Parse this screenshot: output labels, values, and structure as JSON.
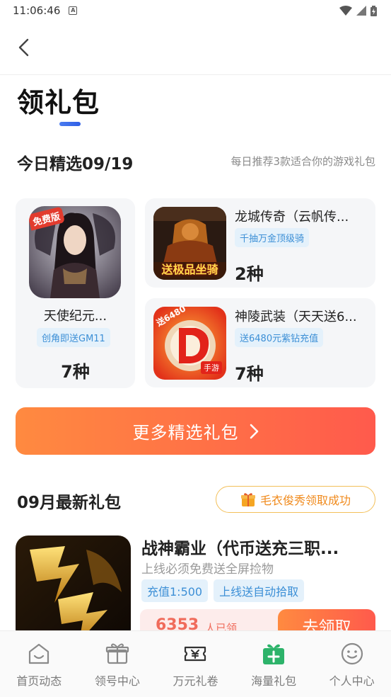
{
  "status_bar": {
    "time": "11:06:46",
    "notif_glyph": "A"
  },
  "header": {
    "back_icon": "chevron-left-icon"
  },
  "page": {
    "title": "领礼包"
  },
  "today": {
    "heading": "今日精选09/19",
    "subtitle": "每日推荐3款适合你的游戏礼包",
    "featured": {
      "name": "天使纪元...",
      "tag": "创角即送GM11",
      "count": "7种",
      "badge": "免费版"
    },
    "games": [
      {
        "name": "龙城传奇（云帆传...",
        "tag": "千抽万金顶级骑",
        "count": "2种",
        "banner": "送极品坐骑"
      },
      {
        "name": "神陵武装（天天送6...",
        "tag": "送6480元紫钻充值",
        "count": "7种",
        "badge": "送6480",
        "sub_badge": "手游"
      }
    ]
  },
  "more_button": {
    "label": "更多精选礼包"
  },
  "monthly": {
    "heading": "09月最新礼包",
    "success_text": "毛衣俊秀领取成功"
  },
  "game_item": {
    "name": "战神霸业（代币送充三职...",
    "desc": "上线必须免费送全屏捡物",
    "tags": [
      "充值1:500",
      "上线送自动拾取"
    ],
    "claimed_count": "6353",
    "claimed_text": "人已领",
    "claim_label": "去领取"
  },
  "tab_bar": {
    "items": [
      {
        "label": "首页动态",
        "icon": "home-face-icon"
      },
      {
        "label": "领号中心",
        "icon": "gift-outline-icon"
      },
      {
        "label": "万元礼卷",
        "icon": "ticket-yen-icon"
      },
      {
        "label": "海量礼包",
        "icon": "gift-green-icon"
      },
      {
        "label": "个人中心",
        "icon": "smiley-icon"
      }
    ]
  },
  "colors": {
    "accent_orange": "#ff6a45",
    "tag_blue": "#3c8fd6",
    "underline_blue": "#3b6ee8",
    "active_green": "#2db36a"
  }
}
